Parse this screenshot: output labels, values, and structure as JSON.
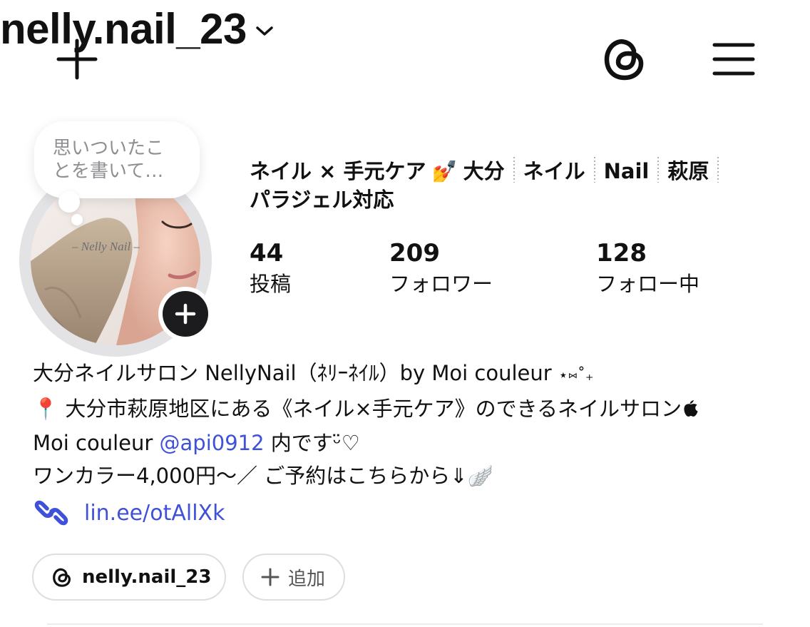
{
  "header": {
    "username": "nelly.nail_23",
    "icons": [
      "plus-icon",
      "chevron-down-icon",
      "threads-icon",
      "hamburger-menu-icon"
    ]
  },
  "note": {
    "placeholder": "思いついたことを書いて…"
  },
  "avatar": {
    "watermark": "– Nelly Nail –",
    "add_icon": "plus-icon"
  },
  "profile": {
    "name_parts": [
      "ネイル × 手元ケア",
      "💅",
      "大分",
      "ネイル",
      "Nail",
      "萩原",
      "パラジェル対応"
    ]
  },
  "stats": [
    {
      "value": "44",
      "label": "投稿"
    },
    {
      "value": "209",
      "label": "フォロワー"
    },
    {
      "value": "128",
      "label": "フォロー中"
    }
  ],
  "bio": {
    "line1": "大分ネイルサロン NellyNail（ﾈﾘｰﾈｲﾙ）by Moi couleur",
    "line1_deco": "⋆⑅˚₊",
    "line2_pin": "📍",
    "line2": "大分市萩原地区にある《ネイル×手元ケア》のできるネイルサロン",
    "line2_end": "",
    "line3_prefix": "Moi couleur ",
    "line3_mention": "@api0912",
    "line3_suffix": " 内です",
    "line3_deco": "ᵕ̈♡",
    "line4": "ワンカラー4,000円〜／ ご予約はこちらから⇓",
    "line4_deco": "🪽"
  },
  "link": {
    "icon": "link-icon",
    "text": "lin.ee/otAllXk"
  },
  "chips": {
    "threads_label": "nelly.nail_23",
    "add_label": "追加"
  },
  "colors": {
    "link": "#3f51d9",
    "text": "#111111",
    "muted": "#8e8e93"
  }
}
